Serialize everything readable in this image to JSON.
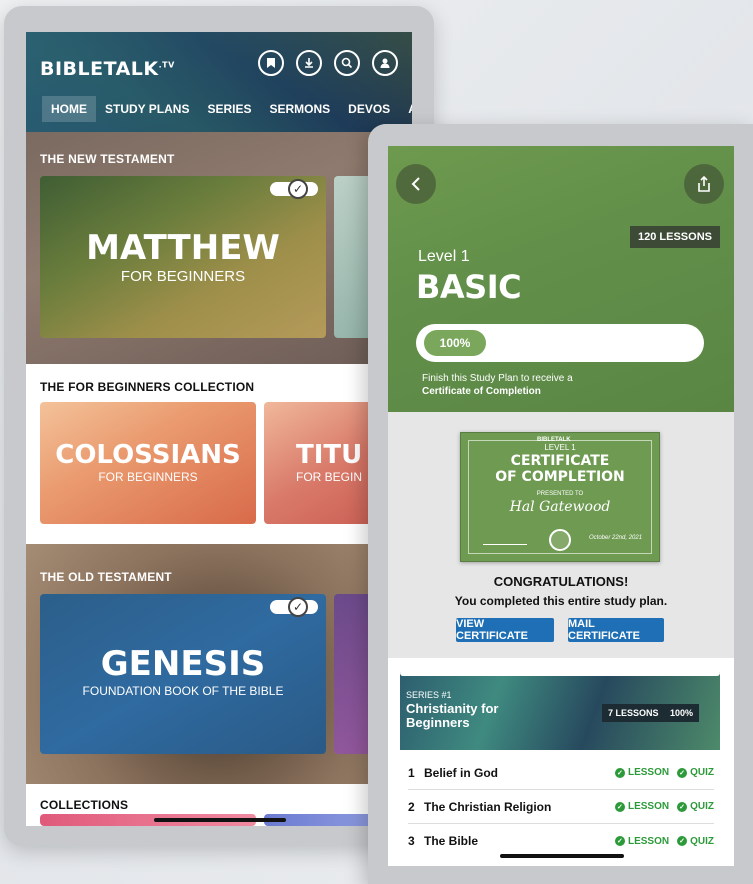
{
  "screen1": {
    "logo": "BIBLETALK",
    "logo_suffix": ".TV",
    "header_icons": [
      "bookmark-icon",
      "download-icon",
      "search-icon",
      "user-icon"
    ],
    "nav": [
      "HOME",
      "STUDY PLANS",
      "SERIES",
      "SERMONS",
      "DEVOS",
      "ARTIC"
    ],
    "sections": {
      "new_testament": "THE NEW TESTAMENT",
      "for_beginners": "THE FOR BEGINNERS COLLECTION",
      "old_testament": "THE OLD TESTAMENT",
      "collections": "COLLECTIONS"
    },
    "cards": {
      "matthew_title": "MATTHEW",
      "matthew_sub": "FOR BEGINNERS",
      "colossians_title": "COLOSSIANS",
      "colossians_sub": "FOR BEGINNERS",
      "titus_title": "TITU",
      "titus_sub": "FOR BEGIN",
      "genesis_title": "GENESIS",
      "genesis_sub": "FOUNDATION BOOK OF THE BIBLE"
    }
  },
  "screen2": {
    "lessons_badge": "120 LESSONS",
    "level_label": "Level 1",
    "level_name": "BASIC",
    "progress_text": "100%",
    "progress_value": 1.0,
    "finish_line1": "Finish this Study Plan to receive a",
    "finish_line2": "Certificate of Completion",
    "certificate": {
      "level": "LEVEL 1",
      "title1": "CERTIFICATE",
      "title2": "OF COMPLETION",
      "presented": "PRESENTED TO",
      "name": "Hal Gatewood",
      "date": "October 22nd, 2021",
      "brand": "BIBLETALK"
    },
    "congrats": "CONGRATULATIONS!",
    "completed": "You completed this entire study plan.",
    "view_btn": "VIEW CERTIFICATE",
    "mail_btn": "MAIL CERTIFICATE",
    "series": {
      "number": "SERIES #1",
      "title": "Christianity for Beginners",
      "lessons": "7 LESSONS",
      "percent": "100%"
    },
    "lessons": [
      {
        "num": "1",
        "name": "Belief in God",
        "lesson": "LESSON",
        "quiz": "QUIZ"
      },
      {
        "num": "2",
        "name": "The Christian Religion",
        "lesson": "LESSON",
        "quiz": "QUIZ"
      },
      {
        "num": "3",
        "name": "The Bible",
        "lesson": "LESSON",
        "quiz": "QUIZ"
      }
    ]
  },
  "colors": {
    "green": "#62904a",
    "blue_button": "#1e6fb5",
    "check_green": "#2d9a3a"
  }
}
